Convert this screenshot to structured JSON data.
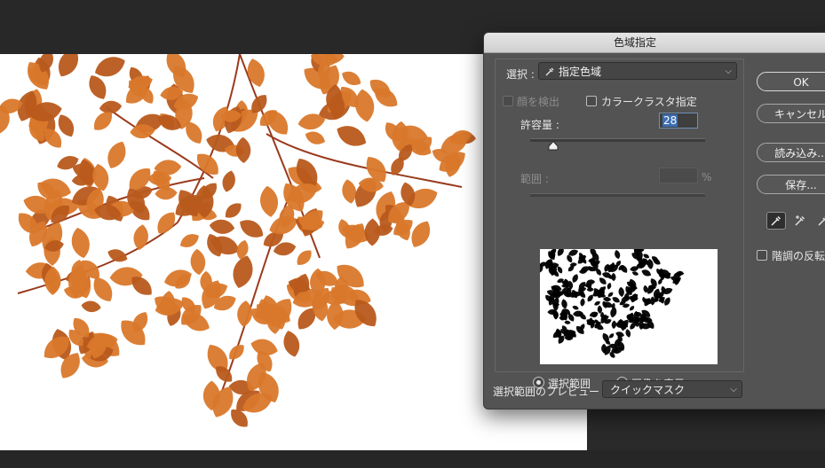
{
  "dialog": {
    "title": "色域指定",
    "select_label": "選択 :",
    "select_value": "指定色域",
    "face_detect_label": "顔を検出",
    "color_cluster_label": "カラークラスタ指定",
    "tolerance_label": "許容量 :",
    "tolerance_value": "28",
    "range_label": "範囲 :",
    "range_unit": "%",
    "radio_selection": "選択範囲",
    "radio_image": "画像を表示",
    "preview_label": "選択範囲のプレビュー :",
    "preview_value": "クイックマスク",
    "ok_label": "OK",
    "cancel_label": "キャンセル",
    "load_label": "読み込み...",
    "save_label": "保存...",
    "invert_label": "階調の反転",
    "tolerance_slider_fraction": 0.13
  },
  "colors": {
    "leaf": "#d9782b",
    "leaf_dark": "#b85a1c",
    "branch": "#9a3a1c",
    "dialog_bg": "#535353"
  },
  "icons": {
    "select_icon": "eyedropper-icon",
    "tool1": "eyedropper-icon",
    "tool2": "eyedropper-plus-icon",
    "tool3": "eyedropper-minus-icon"
  }
}
